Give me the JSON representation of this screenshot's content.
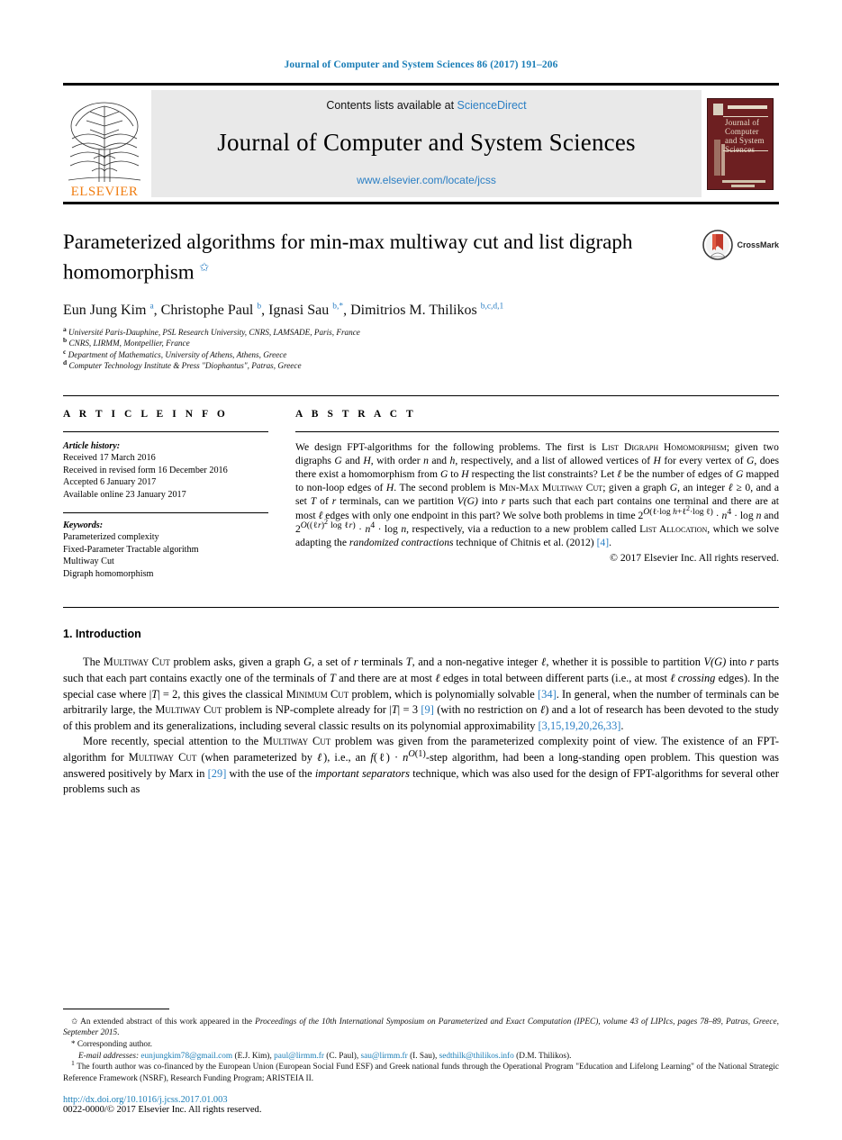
{
  "running_head": "Journal of Computer and System Sciences 86 (2017) 191–206",
  "masthead": {
    "contents_prefix": "Contents lists available at ",
    "sciencedirect": "ScienceDirect",
    "journal_title": "Journal of Computer and System Sciences",
    "journal_url": "www.elsevier.com/locate/jcss",
    "publisher_wordmark": "ELSEVIER",
    "cover": {
      "line1": "Journal of",
      "line2": "Computer",
      "line3": "and System",
      "line4": "Sciences"
    }
  },
  "article": {
    "title": "Parameterized algorithms for min-max multiway cut and list digraph homomorphism",
    "title_footnote_mark": "✩",
    "crossmark_label": "CrossMark",
    "authors": "Eun Jung Kim a, Christophe Paul b, Ignasi Sau b,*, Dimitrios M. Thilikos b,c,d,1",
    "author_list": [
      {
        "name": "Eun Jung Kim",
        "marks": "a"
      },
      {
        "name": "Christophe Paul",
        "marks": "b"
      },
      {
        "name": "Ignasi Sau",
        "marks": "b,*"
      },
      {
        "name": "Dimitrios M. Thilikos",
        "marks": "b,c,d,1"
      }
    ],
    "affiliations": [
      {
        "mark": "a",
        "text": "Université Paris-Dauphine, PSL Research University, CNRS, LAMSADE, Paris, France"
      },
      {
        "mark": "b",
        "text": "CNRS, LIRMM, Montpellier, France"
      },
      {
        "mark": "c",
        "text": "Department of Mathematics, University of Athens, Athens, Greece"
      },
      {
        "mark": "d",
        "text": "Computer Technology Institute & Press \"Diophantus\", Patras, Greece"
      }
    ]
  },
  "article_info": {
    "heading": "A R T I C L E   I N F O",
    "history_label": "Article history:",
    "history": [
      "Received 17 March 2016",
      "Received in revised form 16 December 2016",
      "Accepted 6 January 2017",
      "Available online 23 January 2017"
    ],
    "keywords_label": "Keywords:",
    "keywords": [
      "Parameterized complexity",
      "Fixed-Parameter Tractable algorithm",
      "Multiway Cut",
      "Digraph homomorphism"
    ]
  },
  "abstract": {
    "heading": "A B S T R A C T",
    "text_parts": {
      "p1": "We design FPT-algorithms for the following problems. The first is ",
      "sc1": "List Digraph Homomorphism",
      "p2": "; given two digraphs ",
      "i_G": "G",
      "p3": " and ",
      "i_H": "H",
      "p4": ", with order ",
      "i_n": "n",
      "p5": " and ",
      "i_h": "h",
      "p6": ", respectively, and a list of allowed vertices of ",
      "p7": " for every vertex of ",
      "p8": ", does there exist a homomorphism from ",
      "p9": " to ",
      "p10": " respecting the list constraints? Let ",
      "i_ell": "ℓ",
      "p11": " be the number of edges of ",
      "p12": " mapped to non-loop edges of ",
      "p13": ". The second problem is ",
      "sc2": "Min-Max Multiway Cut",
      "p14": "; given a graph ",
      "p15": ", an integer ",
      "p16": " ≥ 0, and a set ",
      "i_T": "T",
      "p17": " of ",
      "i_r": "r",
      "p18": " terminals, can we partition ",
      "i_VG": "V(G)",
      "p19": " into ",
      "p20": " parts such that each part contains one terminal and there are at most ",
      "p21": " edges with only one endpoint in this part? We solve both problems in time ",
      "formula1": "2^O(ℓ·log h + ℓ²·log ℓ) · n⁴ · log n",
      "p22": " and ",
      "formula2": "2^O((ℓr)² log ℓr) · n⁴ · log n",
      "p23": ", respectively, via a reduction to a new problem called ",
      "sc3": "List Allocation",
      "p24": ", which we solve adapting the ",
      "i_rc": "randomized contractions",
      "p25": " technique of Chitnis et al. (2012) ",
      "ref1": "[4]",
      "p26": "."
    },
    "copyright": "© 2017 Elsevier Inc. All rights reserved."
  },
  "section": {
    "number_title": "1. Introduction",
    "paragraph1": {
      "t1": "The ",
      "sc1": "Multiway Cut",
      "t2": " problem asks, given a graph ",
      "i1": "G",
      "t3": ", a set of ",
      "i2": "r",
      "t4": " terminals ",
      "i3": "T",
      "t5": ", and a non-negative integer ",
      "i4": "ℓ",
      "t6": ", whether it is possible to partition ",
      "i5": "V(G)",
      "t7": " into ",
      "i6": "r",
      "t8": " parts such that each part contains exactly one of the terminals of ",
      "i7": "T",
      "t9": " and there are at most ",
      "i8": "ℓ",
      "t10": " edges in total between different parts (i.e., at most ",
      "i9": "ℓ crossing",
      "t11": " edges). In the special case where |",
      "i10": "T",
      "t12": "| = 2, this gives the classical ",
      "sc2": "Minimum Cut",
      "t13": " problem, which is polynomially solvable ",
      "ref1": "[34]",
      "t14": ". In general, when the number of terminals can be arbitrarily large, the ",
      "sc3": "Multiway Cut",
      "t15": " problem is NP-complete already for |",
      "i11": "T",
      "t16": "| = 3 ",
      "ref2": "[9]",
      "t17": " (with no restriction on ",
      "i12": "ℓ",
      "t18": ") and a lot of research has been devoted to the study of this problem and its generalizations, including several classic results on its polynomial approximability ",
      "ref3": "[3,15,19,20,26,33]",
      "t19": "."
    },
    "paragraph2": {
      "t1": "More recently, special attention to the ",
      "sc1": "Multiway Cut",
      "t2": " problem was given from the parameterized complexity point of view. The existence of an FPT-algorithm for ",
      "sc2": "Multiway Cut",
      "t3": " (when parameterized by ",
      "i1": "ℓ",
      "t4": "), i.e., an ",
      "f1": "f(ℓ) · n^O(1)",
      "t5": "-step algorithm, had been a long-standing open problem. This question was answered positively by Marx in ",
      "ref1": "[29]",
      "t6": " with the use of the ",
      "i2": "important separators",
      "t7": " technique, which was also used for the design of FPT-algorithms for several other problems such as"
    }
  },
  "footnotes": {
    "star_mark": "✩",
    "star_text_a": " An extended abstract of this work appeared in the ",
    "star_text_i": "Proceedings of the 10th International Symposium on Parameterized and Exact Computation (IPEC), volume 43 of LIPIcs, pages 78–89, Patras, Greece, September 2015",
    "star_text_b": ".",
    "corr_mark": "*",
    "corr_text": "Corresponding author.",
    "email_label": "E-mail addresses:",
    "emails": [
      {
        "address": "eunjungkim78@gmail.com",
        "who": "(E.J. Kim),"
      },
      {
        "address": "paul@lirmm.fr",
        "who": "(C. Paul),"
      },
      {
        "address": "sau@lirmm.fr",
        "who": "(I. Sau),"
      },
      {
        "address": "sedthilk@thilikos.info",
        "who": "(D.M. Thilikos)."
      }
    ],
    "note1_mark": "1",
    "note1_text": "The fourth author was co-financed by the European Union (European Social Fund ESF) and Greek national funds through the Operational Program \"Education and Lifelong Learning\" of the National Strategic Reference Framework (NSRF), Research Funding Program; ARISTEIA II.",
    "doi": "http://dx.doi.org/10.1016/j.jcss.2017.01.003",
    "issn_line": "0022-0000/© 2017 Elsevier Inc. All rights reserved."
  },
  "colors": {
    "link": "#1a7db6",
    "accent": "#2b7fc4",
    "elsevier_orange": "#f07e13",
    "cover_maroon": "#6d1f21"
  }
}
